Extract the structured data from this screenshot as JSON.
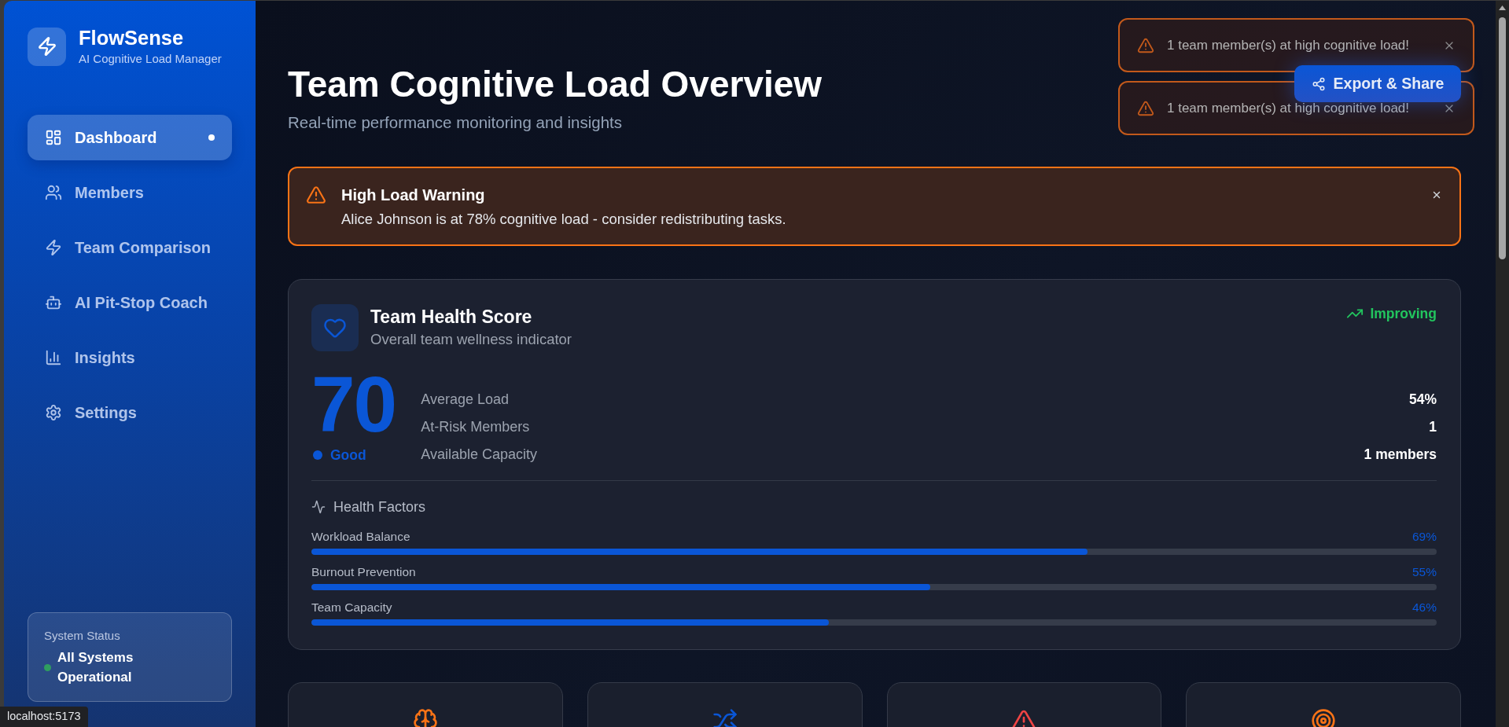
{
  "sidebar": {
    "brand": {
      "name": "FlowSense",
      "tagline": "AI Cognitive Load Manager"
    },
    "nav": [
      {
        "label": "Dashboard",
        "selected": true
      },
      {
        "label": "Members",
        "selected": false
      },
      {
        "label": "Team Comparison",
        "selected": false
      },
      {
        "label": "AI Pit-Stop Coach",
        "selected": false
      },
      {
        "label": "Insights",
        "selected": false
      },
      {
        "label": "Settings",
        "selected": false
      }
    ],
    "system_status": {
      "label": "System Status",
      "status": "All Systems Operational",
      "online": true
    }
  },
  "header": {
    "title": "Team Cognitive Load Overview",
    "subtitle": "Real-time performance monitoring and insights",
    "export_button": "Export & Share"
  },
  "toasts": [
    {
      "message": "1 team member(s) at high cognitive load!"
    },
    {
      "message": "1 team member(s) at high cognitive load!"
    }
  ],
  "alert": {
    "title": "High Load Warning",
    "message": "Alice Johnson is at 78% cognitive load - consider redistributing tasks."
  },
  "health": {
    "title": "Team Health Score",
    "subtitle": "Overall team wellness indicator",
    "trend": "Improving",
    "score": "70",
    "rating": "Good",
    "stats": [
      {
        "label": "Average Load",
        "value": "54%"
      },
      {
        "label": "At-Risk Members",
        "value": "1"
      },
      {
        "label": "Available Capacity",
        "value": "1 members"
      }
    ],
    "factors_title": "Health Factors",
    "factors": [
      {
        "label": "Workload Balance",
        "reading": "69%",
        "level": 0.69
      },
      {
        "label": "Burnout Prevention",
        "reading": "55%",
        "level": 0.55
      },
      {
        "label": "Team Capacity",
        "reading": "46%",
        "level": 0.46
      }
    ]
  },
  "metric_cards": [
    {
      "kind": "brain"
    },
    {
      "kind": "shuffle"
    },
    {
      "kind": "alert"
    },
    {
      "kind": "target"
    }
  ],
  "browser_status": "localhost:5173"
}
